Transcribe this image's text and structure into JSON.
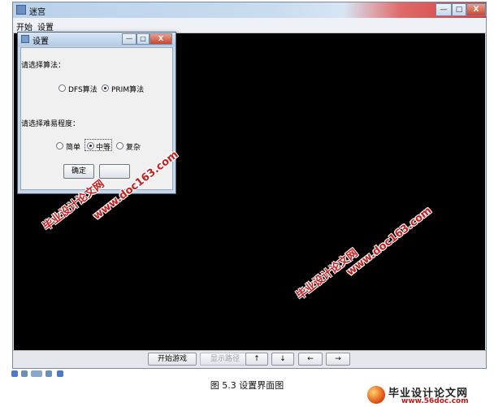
{
  "window": {
    "title": "迷宫",
    "controls": {
      "minimize": "—",
      "maximize": "□",
      "close": "X"
    }
  },
  "menu": {
    "items": [
      "开始",
      "设置"
    ]
  },
  "toolbar": {
    "start_game": "开始游戏",
    "show_path": "显示路径",
    "up": "↑",
    "down": "↓",
    "left": "←",
    "right": "→"
  },
  "dialog": {
    "title": "设置",
    "controls": {
      "minimize": "—",
      "maximize": "□",
      "close": "X"
    },
    "algorithm": {
      "prompt": "请选择算法：",
      "options": [
        "DFS算法",
        "PRIM算法"
      ],
      "selected": "PRIM算法"
    },
    "difficulty": {
      "prompt": "请选择难易程度：",
      "options": [
        "简单",
        "中等",
        "复杂"
      ],
      "selected": "中等"
    },
    "confirm_label": "确定"
  },
  "caption": "图 5.3 设置界面图",
  "watermarks": {
    "site_cn": "毕业设计论文网",
    "url": "www.doc163.com",
    "logo_url": "www.56doc.com"
  },
  "colors": {
    "canvas": "#000000",
    "watermark": "#c81e1e",
    "titlebar": "#b9d1ea",
    "close": "#c9452c"
  }
}
